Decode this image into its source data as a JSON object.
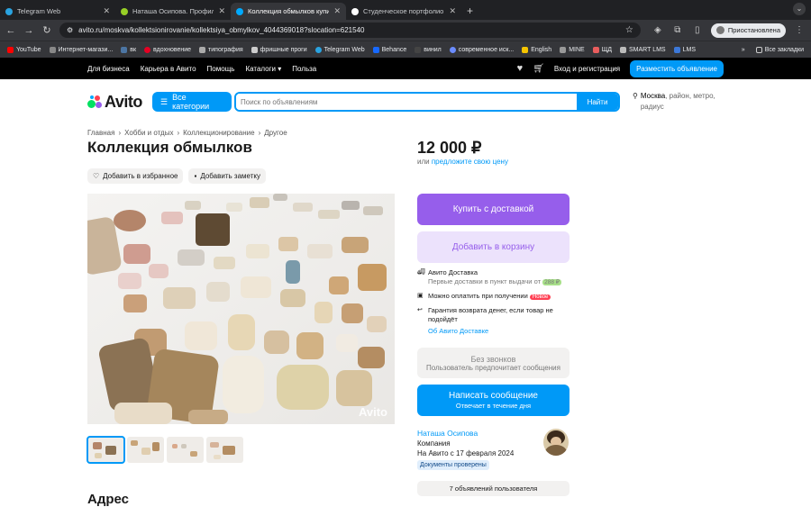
{
  "browser": {
    "tabs": [
      {
        "title": "Telegram Web",
        "color": "#2aa3e0",
        "active": false
      },
      {
        "title": "Наташа Осипова. Профиль",
        "color": "#97cf26",
        "active": false
      },
      {
        "title": "Коллекция обмылков купить",
        "color": "#00aaff",
        "active": true
      },
      {
        "title": "Студенческое портфолио /",
        "color": "#ffffff",
        "active": false
      }
    ],
    "url": "avito.ru/moskva/kollektsionirovanie/kollektsiya_obmylkov_4044369018?slocation=621540",
    "profile_label": "Приостановлена",
    "bookmarks": [
      {
        "label": "YouTube",
        "color": "#ff0000"
      },
      {
        "label": "Интернет-магази...",
        "color": "#888888"
      },
      {
        "label": "вк",
        "color": "#4c75a3"
      },
      {
        "label": "вдохновение",
        "color": "#e60023"
      },
      {
        "label": "типография",
        "color": "#aaaaaa"
      },
      {
        "label": "фришные проги",
        "color": "#cccccc"
      },
      {
        "label": "Telegram Web",
        "color": "#2aa3e0"
      },
      {
        "label": "Behance",
        "color": "#1769ff"
      },
      {
        "label": "винил",
        "color": "#444444"
      },
      {
        "label": "современное иск...",
        "color": "#6b8cff"
      },
      {
        "label": "English",
        "color": "#f5c400"
      },
      {
        "label": "MINE",
        "color": "#999999"
      },
      {
        "label": "ЩД",
        "color": "#e85d5d"
      },
      {
        "label": "SMART LMS",
        "color": "#bbbbbb"
      },
      {
        "label": "LMS",
        "color": "#3c78d8"
      }
    ],
    "more": "»",
    "all_bookmarks": "Все закладки"
  },
  "topnav": {
    "links": [
      "Для бизнеса",
      "Карьера в Авито",
      "Помощь",
      "Каталоги ▾",
      "Польза"
    ],
    "login": "Вход и регистрация",
    "post": "Разместить объявление"
  },
  "header": {
    "logo": "Avito",
    "categories": "Все категории",
    "search_placeholder": "Поиск по объявлениям",
    "search_button": "Найти",
    "location_city": "Москва",
    "location_rest": ", район, метро, радиус"
  },
  "breadcrumbs": [
    "Главная",
    "Хобби и отдых",
    "Коллекционирование",
    "Другое"
  ],
  "listing": {
    "title": "Коллекция обмылков",
    "favorite": "Добавить в избранное",
    "note": "Добавить заметку",
    "watermark": "Avito",
    "address_title": "Адрес"
  },
  "buybox": {
    "price": "12 000 ₽",
    "or": "или",
    "offer_link": "предложите свою цену",
    "buy_delivery": "Купить с доставкой",
    "add_cart": "Добавить в корзину",
    "delivery_title": "Авито Доставка",
    "delivery_sub": "Первые доставки в пункт выдачи от",
    "delivery_price": "288 ₽",
    "pay_on_receipt": "Можно оплатить при получении",
    "new_badge": "Новое",
    "guarantee": "Гарантия возврата денег, если товар не подойдёт",
    "about_delivery": "Об Авито Доставке",
    "no_calls": "Без звонков",
    "no_calls_sub": "Пользователь предпочитает сообщения",
    "write": "Написать сообщение",
    "write_sub": "Отвечает в течение дня"
  },
  "seller": {
    "name": "Наташа Осипова",
    "type": "Компания",
    "since": "На Авито с 17 февраля 2024",
    "docs": "Документы проверены",
    "listings": "7 объявлений пользователя"
  }
}
